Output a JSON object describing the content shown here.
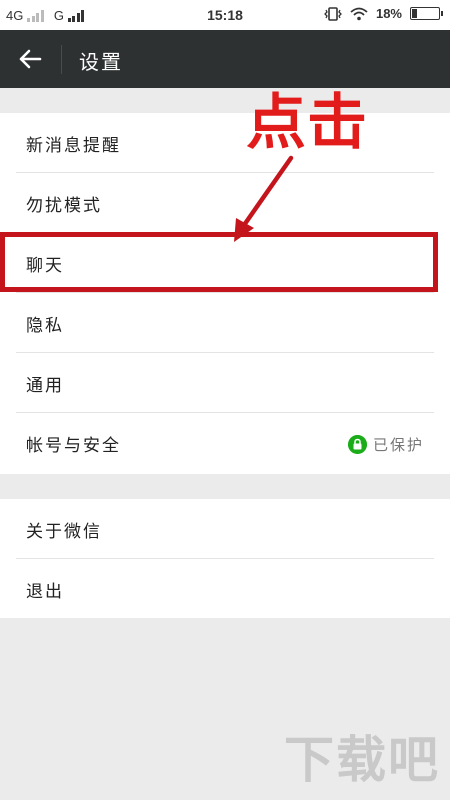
{
  "status_bar": {
    "network1": "4G",
    "network2": "G",
    "time": "15:18",
    "battery": "18%",
    "battery_level": 0.18
  },
  "header": {
    "title": "设置"
  },
  "group1": {
    "items": [
      {
        "label": "新消息提醒"
      },
      {
        "label": "勿扰模式"
      },
      {
        "label": "聊天"
      },
      {
        "label": "隐私"
      },
      {
        "label": "通用"
      },
      {
        "label": "帐号与安全",
        "status": "已保护"
      }
    ]
  },
  "group2": {
    "items": [
      {
        "label": "关于微信"
      },
      {
        "label": "退出"
      }
    ]
  },
  "annotation": {
    "text": "点击",
    "color": "#e21b1b"
  },
  "watermark": {
    "text": "下载吧"
  },
  "colors": {
    "titlebar": "#2d3132",
    "accent_green": "#1aad19",
    "highlight_red": "#c4151c"
  }
}
